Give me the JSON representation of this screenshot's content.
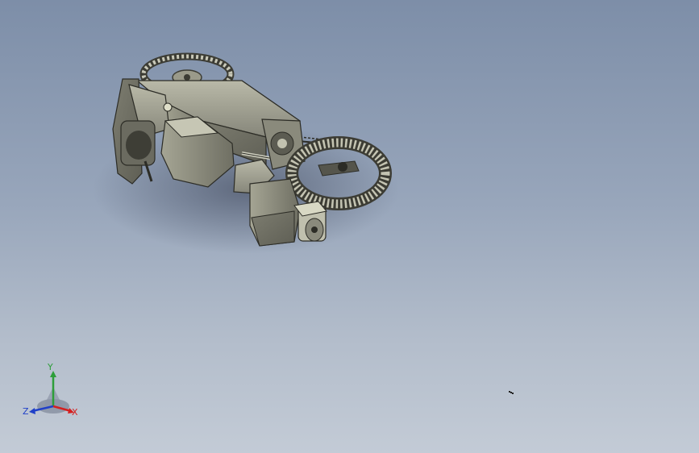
{
  "viewport": {
    "background_top": "#7d8ea8",
    "background_bottom": "#c3cbd6",
    "model_body_color": "#8e8e80",
    "model_shadow_color": "#5a6275"
  },
  "triad": {
    "x_label": "X",
    "y_label": "Y",
    "z_label": "Z",
    "x_color": "#d42020",
    "y_color": "#2e9e3a",
    "z_color": "#2040c8"
  },
  "cursor": {
    "icon": "cursor-dot-icon"
  }
}
